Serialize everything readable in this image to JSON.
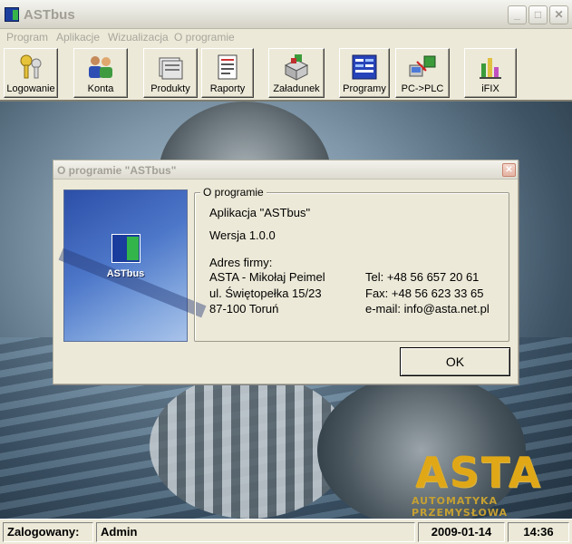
{
  "window": {
    "title": "ASTbus",
    "min_glyph": "_",
    "max_glyph": "□",
    "close_glyph": "✕"
  },
  "menu": [
    "Program",
    "Aplikacje",
    "Wizualizacja",
    "O programie"
  ],
  "toolbar": [
    {
      "label": "Logowanie",
      "icon": "keys-icon"
    },
    {
      "label": "Konta",
      "icon": "users-icon"
    },
    {
      "label": "Produkty",
      "icon": "folders-icon"
    },
    {
      "label": "Raporty",
      "icon": "report-icon"
    },
    {
      "label": "Załadunek",
      "icon": "loading-icon"
    },
    {
      "label": "Programy",
      "icon": "programs-icon"
    },
    {
      "label": "PC->PLC",
      "icon": "pc-plc-icon"
    },
    {
      "label": "iFIX",
      "icon": "ifix-icon"
    }
  ],
  "background_logo": {
    "brand": "ASTA",
    "subtitle": "AUTOMATYKA PRZEMYSŁOWA"
  },
  "status": {
    "logged_label": "Zalogowany:",
    "user": "Admin",
    "date": "2009-01-14",
    "time": "14:36"
  },
  "dialog": {
    "title": "O programie \"ASTbus\"",
    "close_glyph": "✕",
    "logo_label": "ASTbus",
    "group_title": "O programie",
    "app_line": "Aplikacja \"ASTbus\"",
    "version_line": "Wersja 1.0.0",
    "address_label": "Adres firmy:",
    "address": [
      "ASTA - Mikołaj Peimel",
      "ul. Świętopełka 15/23",
      "87-100 Toruń"
    ],
    "contact": [
      "Tel: +48 56 657 20 61",
      "Fax: +48 56 623 33 65",
      "e-mail: info@asta.net.pl"
    ],
    "ok_label": "OK"
  }
}
